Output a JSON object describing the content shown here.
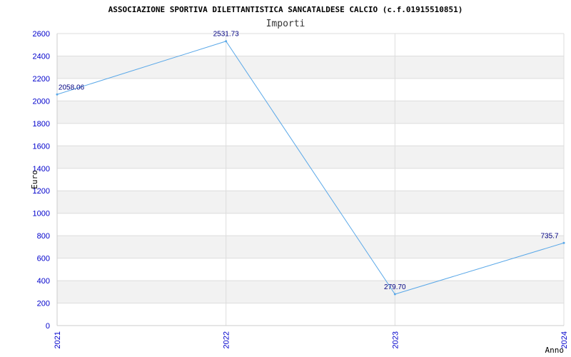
{
  "chart_data": {
    "type": "line",
    "title": "ASSOCIAZIONE SPORTIVA DILETTANTISTICA SANCATALDESE CALCIO (c.f.01915510851)",
    "subtitle": "Importi",
    "xlabel": "Anno",
    "ylabel": "Euro",
    "categories": [
      "2021",
      "2022",
      "2023",
      "2024"
    ],
    "series": [
      {
        "values": [
          2058.06,
          2531.73,
          279.7,
          735.7
        ],
        "labels": [
          "2058.06",
          "2531.73",
          "279.70",
          "735.7"
        ]
      }
    ],
    "ylim": [
      0,
      2600
    ],
    "yticks": [
      0,
      200,
      400,
      600,
      800,
      1000,
      1200,
      1400,
      1600,
      1800,
      2000,
      2200,
      2400,
      2600
    ],
    "grid": true,
    "legend": "none"
  },
  "colors": {
    "line": "#5aa8e8",
    "band": "#f2f2f2",
    "grid": "#dddddd",
    "tick_text": "#0000cc",
    "data_label": "#000080"
  }
}
